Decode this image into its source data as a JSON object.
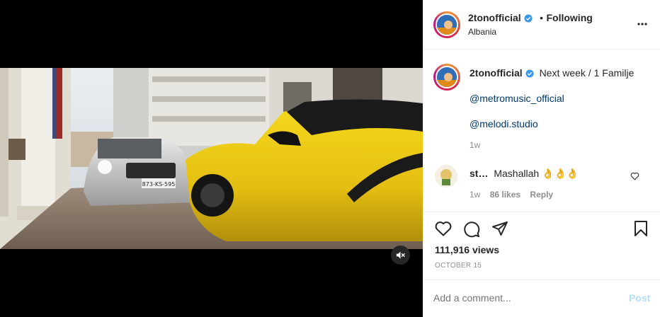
{
  "post": {
    "username": "2tonofficial",
    "follow_separator": "•",
    "follow_status": "Following",
    "location": "Albania",
    "more_icon": "more-horizontal-icon"
  },
  "caption": {
    "username": "2tonofficial",
    "text": "Next week / 1 Familje",
    "mention_1": "@metromusic_official",
    "mention_2": "@melodi.studio",
    "time": "1w"
  },
  "comment": {
    "username": "st…",
    "text": "Mashallah 👌👌👌",
    "time": "1w",
    "likes": "86 likes",
    "reply": "Reply"
  },
  "stats": {
    "views": "111,916 views",
    "date": "OCTOBER 15"
  },
  "composer": {
    "placeholder": "Add a comment...",
    "post_label": "Post"
  },
  "video": {
    "plate": "873-KS-595",
    "muted": true
  },
  "colors": {
    "verified": "#3897f0",
    "link": "#00376b",
    "post_disabled": "#b2dffc"
  }
}
